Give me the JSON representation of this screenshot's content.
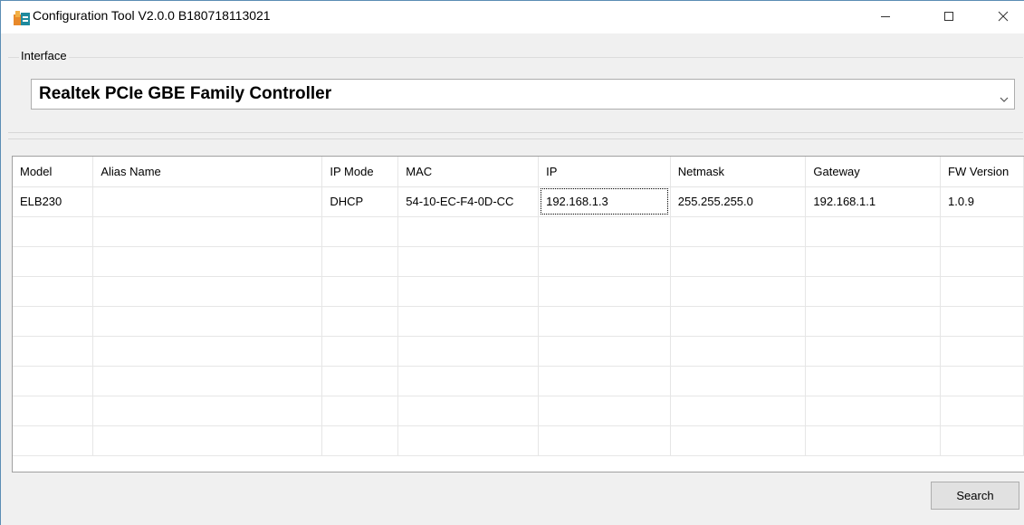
{
  "window": {
    "title": "Configuration Tool V2.0.0 B180718113021"
  },
  "interface": {
    "label": "Interface",
    "selected": "Realtek PCIe GBE Family Controller"
  },
  "grid": {
    "columns": [
      "Model",
      "Alias Name",
      "IP Mode",
      "MAC",
      "IP",
      "Netmask",
      "Gateway",
      "FW Version"
    ],
    "rows": [
      [
        "ELB230",
        "",
        "DHCP",
        "54-10-EC-F4-0D-CC",
        "192.168.1.3",
        "255.255.255.0",
        "192.168.1.1",
        "1.0.9"
      ]
    ],
    "empty_rows": 8
  },
  "buttons": {
    "search": "Search"
  },
  "colors": {
    "accent_border": "#5b8db4",
    "icon_orange": "#e8892a",
    "icon_teal": "#1f8a9e"
  }
}
